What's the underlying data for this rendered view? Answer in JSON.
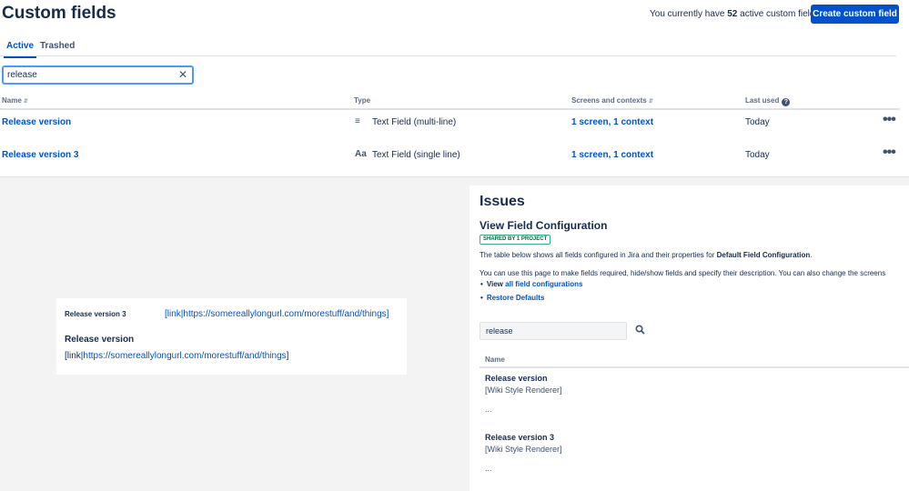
{
  "custom_fields": {
    "title": "Custom fields",
    "count_prefix": "You currently have",
    "count": "52",
    "count_suffix": "active custom fields",
    "create_button": "Create custom field",
    "tabs": [
      "Active",
      "Trashed"
    ],
    "search": {
      "value": "release",
      "clear_icon": "close-icon"
    },
    "columns": {
      "name": "Name",
      "type": "Type",
      "screens": "Screens and contexts",
      "last_used": "Last used"
    },
    "rows": [
      {
        "name": "Release version",
        "type_icon": "≡",
        "type": "Text Field (multi-line)",
        "contexts": "1 screen, 1 context",
        "last_used": "Today"
      },
      {
        "name": "Release version 3",
        "type_icon": "Aa",
        "type": "Text Field (single line)",
        "contexts": "1 screen, 1 context",
        "last_used": "Today"
      }
    ]
  },
  "card": {
    "row1_label": "Release version 3",
    "row1_value": "[link|https://somereallylongurl.com/morestuff/and/things]",
    "row2_label": "Release version",
    "row2_prefix": "[link|",
    "row2_link": "https://somereallylongurl.com/morestuff/and/things",
    "row2_suffix": "]"
  },
  "issues_panel": {
    "title": "Issues",
    "subtitle": "View Field Configuration",
    "badge": "SHARED BY 1 PROJECT",
    "desc1_prefix": "The table below shows all fields configured in Jira and their properties for",
    "desc1_bold": "Default Field Configuration",
    "desc1_suffix": ".",
    "desc2": "You can use this page to make fields required, hide/show fields and specify their description. You can also change the screens",
    "links": {
      "view_prefix": "View",
      "view_link": "all field configurations",
      "restore": "Restore Defaults"
    },
    "filter_value": "release",
    "column_name": "Name",
    "fields": [
      {
        "name": "Release version",
        "renderer": "[Wiki Style Renderer]",
        "ellipsis": "..."
      },
      {
        "name": "Release version 3",
        "renderer": "[Wiki Style Renderer]",
        "ellipsis": "..."
      }
    ]
  }
}
